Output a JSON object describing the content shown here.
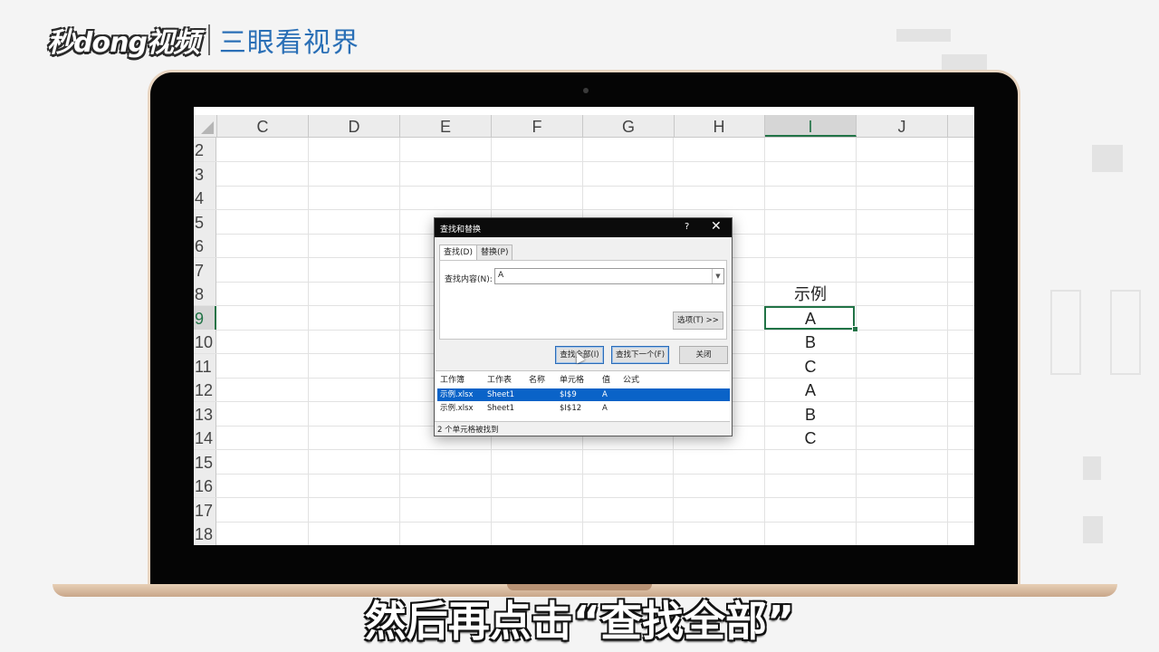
{
  "brand": {
    "logo": "秒dong视频",
    "tagline": "三眼看视界"
  },
  "sheet": {
    "columns": [
      "C",
      "D",
      "E",
      "F",
      "G",
      "H",
      "I",
      "J"
    ],
    "selected_column": "I",
    "rows": [
      "2",
      "3",
      "4",
      "5",
      "6",
      "7",
      "8",
      "9",
      "10",
      "11",
      "12",
      "13",
      "14",
      "15",
      "16",
      "17",
      "18"
    ],
    "selected_row": "9",
    "cells_I": {
      "8": "示例",
      "9": "A",
      "10": "B",
      "11": "C",
      "12": "A",
      "13": "B",
      "14": "C"
    }
  },
  "dialog": {
    "title": "查找和替换",
    "help": "?",
    "close": "✕",
    "tabs": [
      "查找(D)",
      "替换(P)"
    ],
    "find_label": "查找内容(N):",
    "find_value": "A",
    "options_button": "选项(T) >>",
    "find_all_button": "查找全部(I)",
    "find_next_button": "查找下一个(F)",
    "close_button": "关闭",
    "result_headers": [
      "工作簿",
      "工作表",
      "名称",
      "单元格",
      "值",
      "公式"
    ],
    "results": [
      {
        "workbook": "示例.xlsx",
        "sheet": "Sheet1",
        "name": "",
        "cell": "$I$9",
        "value": "A",
        "formula": ""
      },
      {
        "workbook": "示例.xlsx",
        "sheet": "Sheet1",
        "name": "",
        "cell": "$I$12",
        "value": "A",
        "formula": ""
      }
    ],
    "status": "2 个单元格被找到"
  },
  "subtitle": "然后再点击“查找全部”"
}
